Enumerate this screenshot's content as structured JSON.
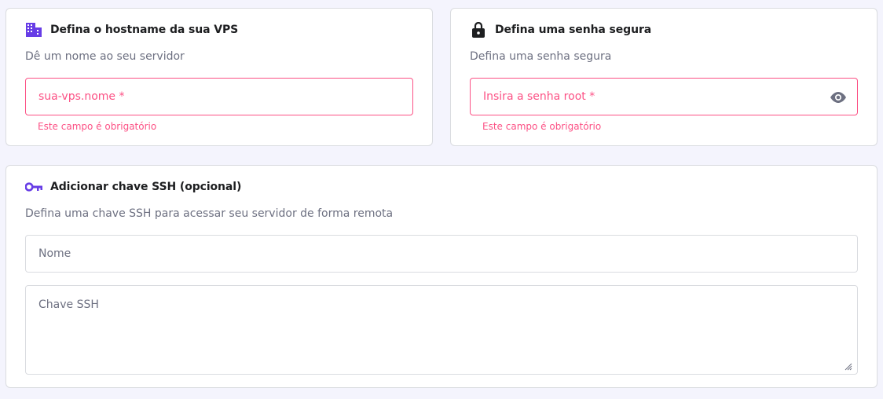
{
  "hostname": {
    "title": "Defina o hostname da sua VPS",
    "subtitle": "Dê um nome ao seu servidor",
    "placeholder": "sua-vps.nome *",
    "error": "Este campo é obrigatório",
    "icon": "building-icon"
  },
  "password": {
    "title": "Defina uma senha segura",
    "subtitle": "Defina uma senha segura",
    "placeholder": "Insira a senha root *",
    "error": "Este campo é obrigatório",
    "icon": "lock-icon",
    "toggle_icon": "eye-icon"
  },
  "ssh": {
    "title": "Adicionar chave SSH (opcional)",
    "subtitle": "Defina uma chave SSH para acessar seu servidor de forma remota",
    "name_placeholder": "Nome",
    "key_placeholder": "Chave SSH",
    "icon": "key-icon"
  },
  "colors": {
    "accent": "#673de6",
    "error": "#fc5185",
    "border": "#dadce0",
    "page_bg": "#f4f4fd"
  }
}
